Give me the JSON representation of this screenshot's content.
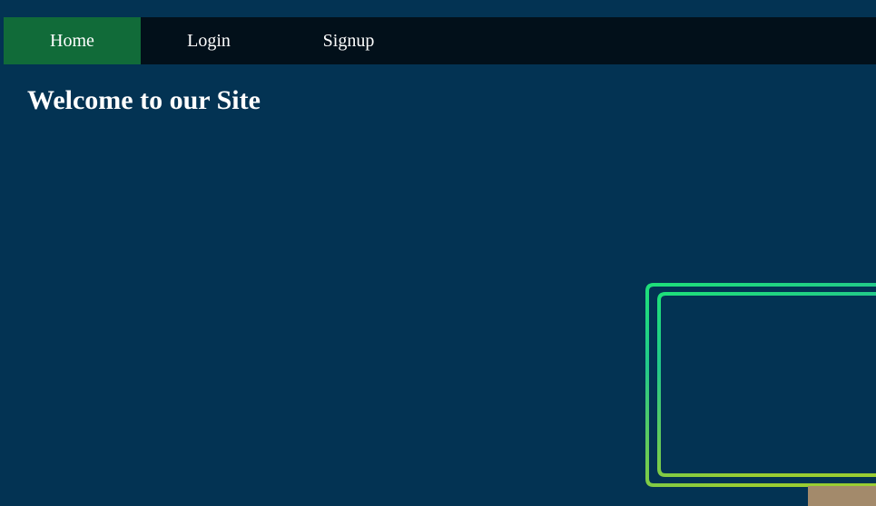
{
  "nav": {
    "items": [
      {
        "label": "Home",
        "active": true
      },
      {
        "label": "Login",
        "active": false
      },
      {
        "label": "Signup",
        "active": false
      }
    ]
  },
  "main": {
    "title": "Welcome to our Site"
  },
  "colors": {
    "background": "#033353",
    "navbar": "#02101a",
    "active_nav": "#116b39",
    "text": "#ffffff",
    "monitor_gradient_start": "#1ee07a",
    "monitor_gradient_end": "#9acd32",
    "stand": "#a38a6b"
  },
  "illustration": {
    "icon": "monitor-illustration"
  }
}
